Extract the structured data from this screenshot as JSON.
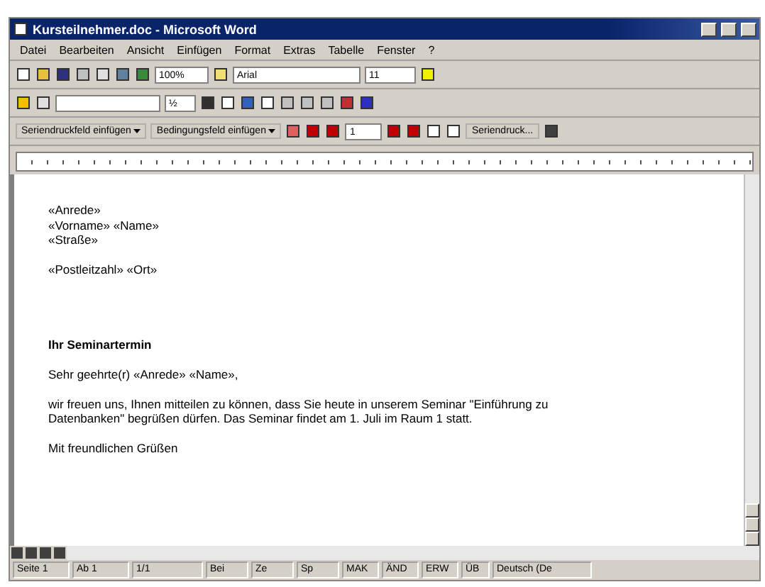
{
  "window": {
    "title": "Kursteilnehmer.doc - Microsoft Word"
  },
  "menu": [
    "Datei",
    "Bearbeiten",
    "Ansicht",
    "Einfügen",
    "Format",
    "Extras",
    "Tabelle",
    "Fenster",
    "?"
  ],
  "standard_toolbar": {
    "zoom": "100%",
    "font": "Arial",
    "size": "11"
  },
  "drawing_toolbar": {
    "line_size": "½"
  },
  "merge_toolbar": {
    "insert_field": "Seriendruckfeld einfügen",
    "insert_condition": "Bedingungsfeld einfügen",
    "record": "1",
    "merge": "Seriendruck..."
  },
  "document": [
    {
      "kind": "text",
      "text": "«Anrede»"
    },
    {
      "kind": "text",
      "text": "«Vorname» «Name»"
    },
    {
      "kind": "text",
      "text": "«Straße»"
    },
    {
      "kind": "blank"
    },
    {
      "kind": "text",
      "text": "«Postleitzahl» «Ort»"
    },
    {
      "kind": "blank"
    },
    {
      "kind": "blank"
    },
    {
      "kind": "blank"
    },
    {
      "kind": "blank"
    },
    {
      "kind": "heading",
      "text": "Ihr Seminartermin"
    },
    {
      "kind": "blank"
    },
    {
      "kind": "text",
      "text": "Sehr geehrte(r) «Anrede» «Name»,"
    },
    {
      "kind": "blank"
    },
    {
      "kind": "text",
      "text": "wir freuen uns, Ihnen mitteilen zu können, dass Sie heute in unserem Seminar \"Einführung zu"
    },
    {
      "kind": "text",
      "text": "Datenbanken\" begrüßen dürfen. Das Seminar findet am 1. Juli im Raum 1 statt."
    },
    {
      "kind": "blank"
    },
    {
      "kind": "text",
      "text": "Mit freundlichen Grüßen"
    }
  ],
  "status_bar": [
    "Seite 1",
    "Ab 1",
    "1/1",
    "Bei",
    "Ze",
    "Sp",
    "MAK",
    "ÄND",
    "ERW",
    "ÜB",
    "Deutsch (De"
  ]
}
